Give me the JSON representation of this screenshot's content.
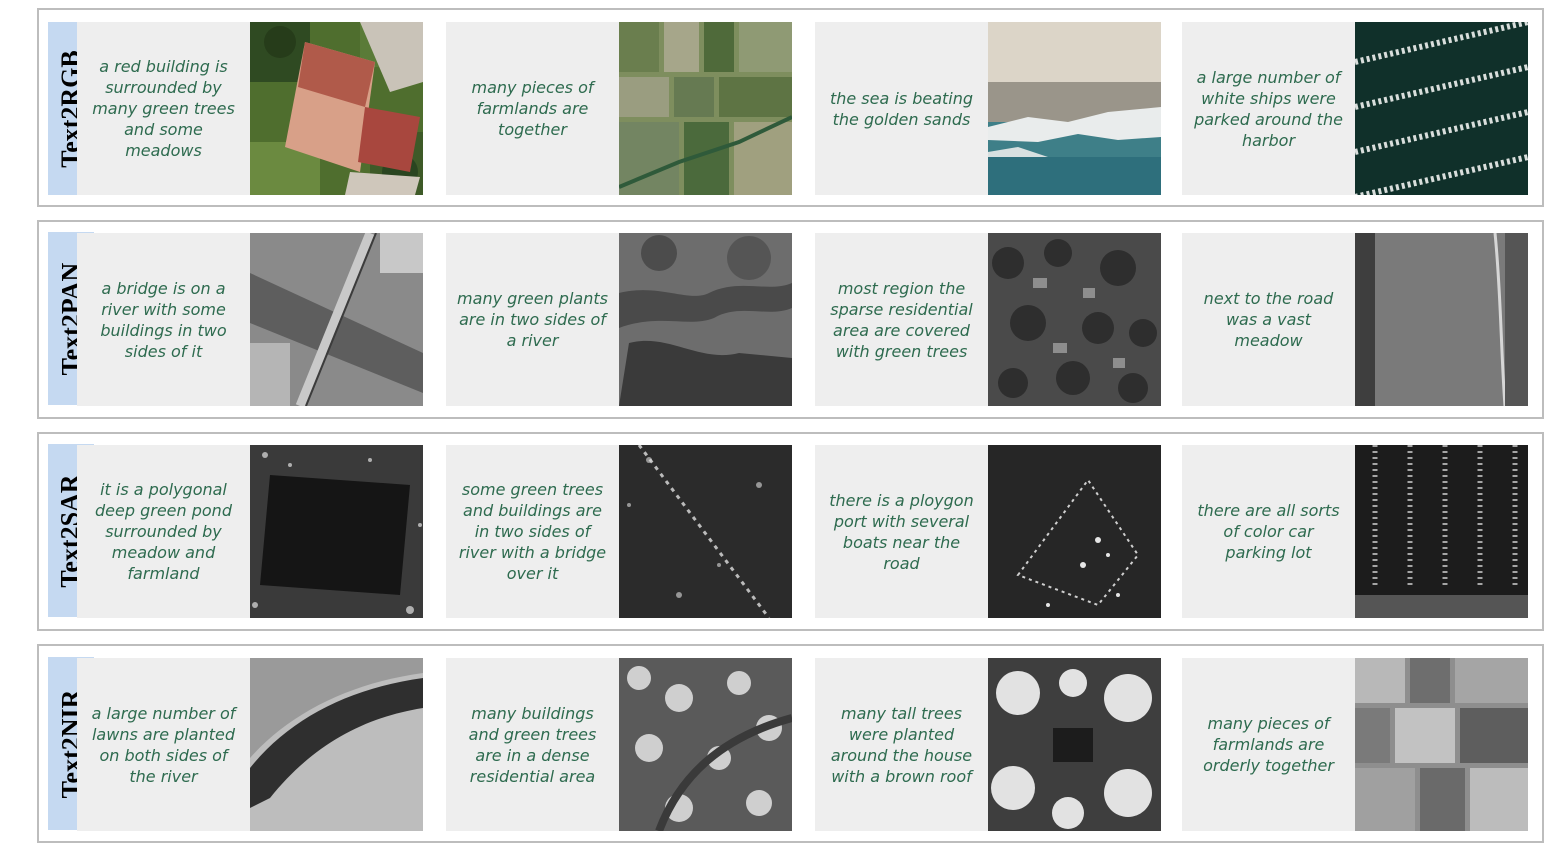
{
  "rows": [
    {
      "label": "Text2RGB",
      "items": [
        {
          "caption": "a red building is surrounded by many green trees and some meadows",
          "image": "aerial-red-roof-building"
        },
        {
          "caption": "many pieces of farmlands are together",
          "image": "aerial-farmland-fields"
        },
        {
          "caption": "the sea is beating the golden sands",
          "image": "aerial-beach-waves"
        },
        {
          "caption": "a large number of white ships were parked around the harbor",
          "image": "aerial-harbor-boats"
        }
      ]
    },
    {
      "label": "Text2PAN",
      "items": [
        {
          "caption": "a bridge is on a river with some buildings in two sides of it",
          "image": "pan-bridge-river"
        },
        {
          "caption": "many green plants are in two sides of a river",
          "image": "pan-river-vegetation"
        },
        {
          "caption": "most region the sparse residential area are covered with green trees",
          "image": "pan-residential-trees"
        },
        {
          "caption": "next to the road was a vast meadow",
          "image": "pan-road-meadow"
        }
      ]
    },
    {
      "label": "Text2SAR",
      "items": [
        {
          "caption": "it is a polygonal deep green pond surrounded by meadow and farmland",
          "image": "sar-pond"
        },
        {
          "caption": "some green trees and buildings are in two sides of river with a bridge over it",
          "image": "sar-river-bridge"
        },
        {
          "caption": "there is a ploygon port with several boats near the road",
          "image": "sar-port"
        },
        {
          "caption": "there are all sorts of color car parking lot",
          "image": "sar-parking-lot"
        }
      ]
    },
    {
      "label": "Text2NIR",
      "items": [
        {
          "caption": "a large number of lawns are planted on both sides of the river",
          "image": "nir-river-lawns"
        },
        {
          "caption": "many buildings and green trees are in a dense residential area",
          "image": "nir-dense-residential"
        },
        {
          "caption": "many tall trees were planted around the house with a brown roof",
          "image": "nir-house-trees"
        },
        {
          "caption": "many pieces of farmlands are orderly together",
          "image": "nir-farmlands"
        }
      ]
    }
  ]
}
